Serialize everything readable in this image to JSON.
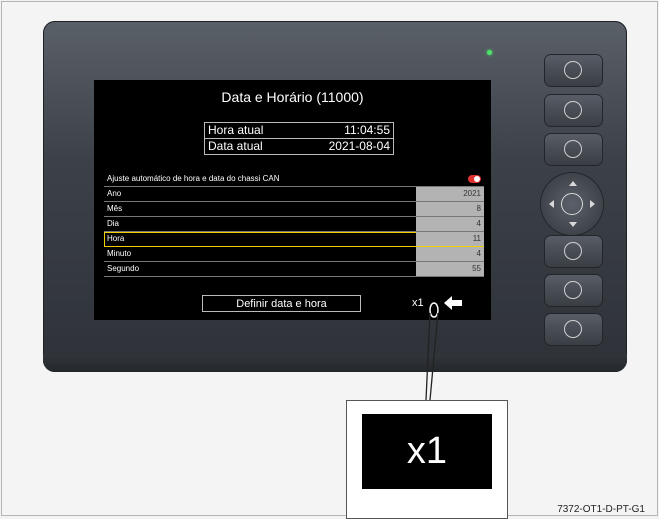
{
  "screen": {
    "title": "Data e Horário (11000)",
    "info": [
      {
        "label": "Hora atual",
        "value": "11:04:55"
      },
      {
        "label": "Data atual",
        "value": "2021-08-04"
      }
    ],
    "auto_sync_label": "Ajuste automático de hora e data do chassi CAN",
    "auto_sync_enabled": true,
    "rows": [
      {
        "label": "Ano",
        "value": "2021"
      },
      {
        "label": "Mês",
        "value": "8"
      },
      {
        "label": "Dia",
        "value": "4"
      },
      {
        "label": "Hora",
        "value": "11",
        "selected": true
      },
      {
        "label": "Minuto",
        "value": "4"
      },
      {
        "label": "Segundo",
        "value": "55"
      }
    ],
    "set_button_label": "Definir data e hora",
    "multiplier": "x1"
  },
  "callout": {
    "zoom_text": "x1"
  },
  "figure_code": "7372-OT1-D-PT-G1",
  "colors": {
    "highlight": "#f0d000",
    "toggle": "#e03030",
    "led": "#4ce36a"
  }
}
